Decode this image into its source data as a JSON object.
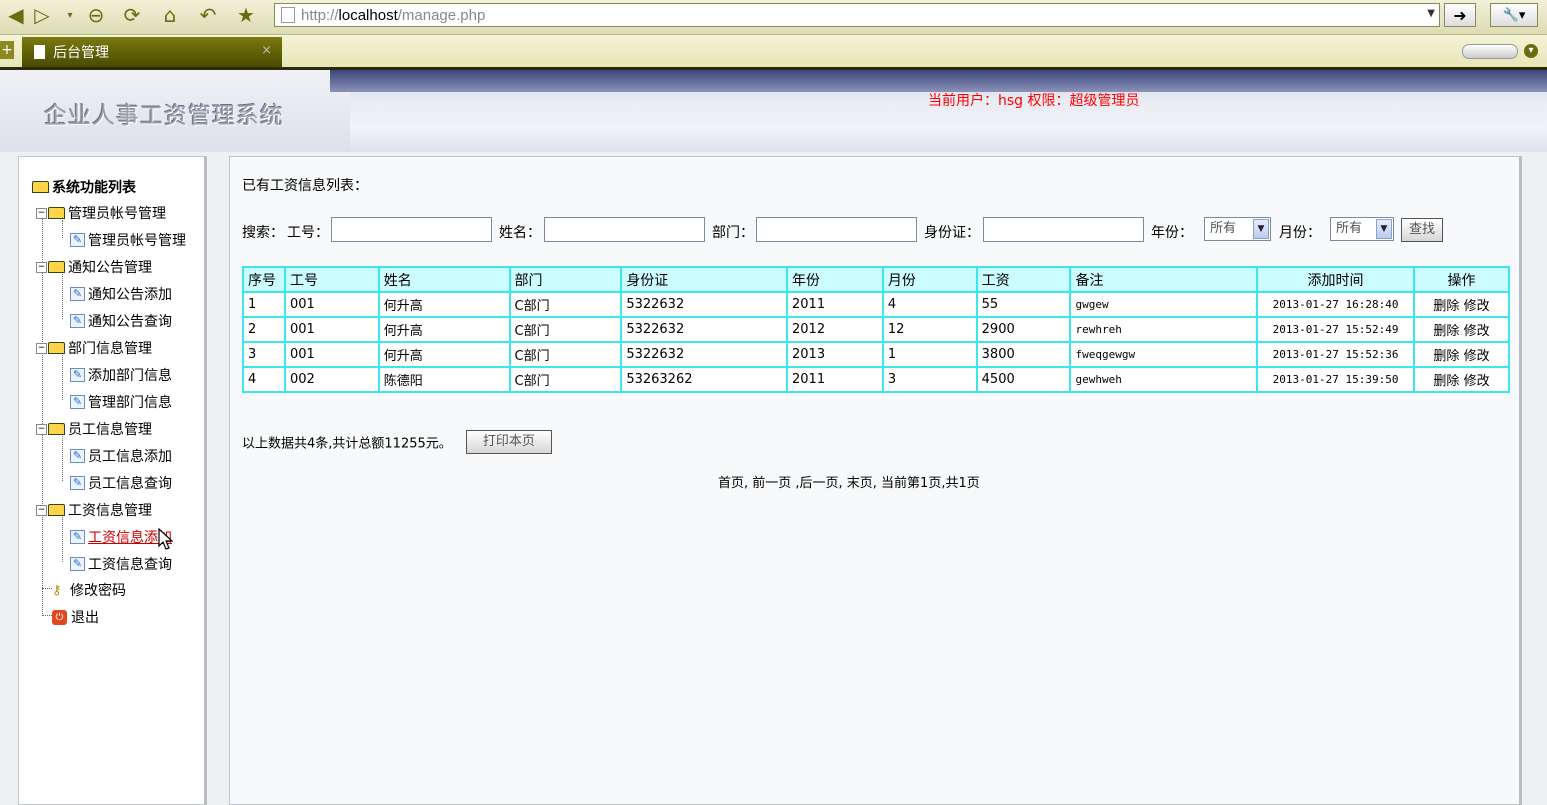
{
  "browser": {
    "url_prefix": "http://",
    "url_host": "localhost",
    "url_path": "/manage.php",
    "tab_title": "后台管理",
    "tab_close": "×"
  },
  "header": {
    "system_title": "企业人事工资管理系统",
    "user_info": "当前用户：hsg  权限：超级管理员"
  },
  "sidebar": {
    "root": "系统功能列表",
    "groups": [
      {
        "label": "管理员帐号管理",
        "items": [
          "管理员帐号管理"
        ]
      },
      {
        "label": "通知公告管理",
        "items": [
          "通知公告添加",
          "通知公告查询"
        ]
      },
      {
        "label": "部门信息管理",
        "items": [
          "添加部门信息",
          "管理部门信息"
        ]
      },
      {
        "label": "员工信息管理",
        "items": [
          "员工信息添加",
          "员工信息查询"
        ]
      },
      {
        "label": "工资信息管理",
        "items": [
          "工资信息添加",
          "工资信息查询"
        ]
      }
    ],
    "change_password": "修改密码",
    "logout": "退出",
    "active_item": "工资信息添加"
  },
  "main": {
    "heading": "已有工资信息列表：",
    "search": {
      "label": "搜索：",
      "empid_label": "工号：",
      "name_label": "姓名：",
      "dept_label": "部门：",
      "idcard_label": "身份证：",
      "year_label": "年份：",
      "year_value": "所有",
      "month_label": "月份：",
      "month_value": "所有",
      "search_button": "查找"
    },
    "table": {
      "headers": [
        "序号",
        "工号",
        "姓名",
        "部门",
        "身份证",
        "年份",
        "月份",
        "工资",
        "备注",
        "添加时间",
        "操作"
      ],
      "rows": [
        {
          "no": "1",
          "empid": "001",
          "name": "何升高",
          "dept": "C部门",
          "idcard": "5322632",
          "year": "2011",
          "month": "4",
          "salary": "55",
          "remark": "gwgew",
          "time": "2013-01-27 16:28:40",
          "delete": "删除",
          "edit": "修改"
        },
        {
          "no": "2",
          "empid": "001",
          "name": "何升高",
          "dept": "C部门",
          "idcard": "5322632",
          "year": "2012",
          "month": "12",
          "salary": "2900",
          "remark": "rewhreh",
          "time": "2013-01-27 15:52:49",
          "delete": "删除",
          "edit": "修改"
        },
        {
          "no": "3",
          "empid": "001",
          "name": "何升高",
          "dept": "C部门",
          "idcard": "5322632",
          "year": "2013",
          "month": "1",
          "salary": "3800",
          "remark": "fweqgewgw",
          "time": "2013-01-27 15:52:36",
          "delete": "删除",
          "edit": "修改"
        },
        {
          "no": "4",
          "empid": "002",
          "name": "陈德阳",
          "dept": "C部门",
          "idcard": "53263262",
          "year": "2011",
          "month": "3",
          "salary": "4500",
          "remark": "gewhweh",
          "time": "2013-01-27 15:39:50",
          "delete": "删除",
          "edit": "修改"
        }
      ]
    },
    "summary": "以上数据共4条,共计总额11255元。",
    "print_button": "打印本页",
    "pager": "首页, 前一页 ,后一页, 末页, 当前第1页,共1页"
  }
}
